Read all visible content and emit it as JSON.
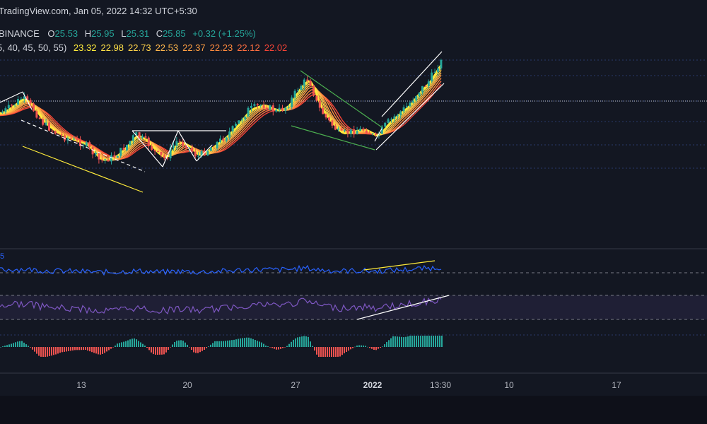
{
  "header": {
    "source": "TradingView.com, Jan 05, 2022 14:32 UTC+5:30",
    "exchange": "BINANCE",
    "ohlc": {
      "o_label": "O",
      "o": "25.53",
      "h_label": "H",
      "h": "25.95",
      "l_label": "L",
      "l": "25.31",
      "c_label": "C",
      "c": "25.85",
      "change": "+0.32 (+1.25%)"
    },
    "ma_params": "5, 40, 45, 50, 55)",
    "ma_values": [
      {
        "value": "23.32",
        "color": "#ffeb3b"
      },
      {
        "value": "22.98",
        "color": "#ffe047"
      },
      {
        "value": "22.73",
        "color": "#ffd24a"
      },
      {
        "value": "22.53",
        "color": "#ffb74d"
      },
      {
        "value": "22.37",
        "color": "#ff9f43"
      },
      {
        "value": "22.23",
        "color": "#ff8a3d"
      },
      {
        "value": "22.12",
        "color": "#ff6e40"
      },
      {
        "value": "22.02",
        "color": "#f44336"
      }
    ]
  },
  "osc_label": "5",
  "x_axis": [
    {
      "label": "13",
      "bold": false
    },
    {
      "label": "20",
      "bold": false
    },
    {
      "label": "27",
      "bold": false
    },
    {
      "label": "2022",
      "bold": true
    },
    {
      "label": "13:30",
      "bold": false
    },
    {
      "label": "10",
      "bold": false
    },
    {
      "label": "17",
      "bold": false
    }
  ],
  "colors": {
    "background": "#131722",
    "up": "#26a69a",
    "down": "#ef5350",
    "grid_dot": "#2a3a6a",
    "osc1": "#2962ff",
    "osc2": "#7e57c2",
    "trendline_yellow": "#ffeb3b",
    "trendline_green": "#4caf50",
    "trendline_white": "#ffffff"
  },
  "chart_data": {
    "type": "candlestick",
    "symbol_exchange": "BINANCE",
    "last": {
      "open": 25.53,
      "high": 25.95,
      "low": 25.31,
      "close": 25.85,
      "change": 0.32,
      "change_pct": 1.25
    },
    "moving_averages": [
      23.32,
      22.98,
      22.73,
      22.53,
      22.37,
      22.23,
      22.12,
      22.02
    ],
    "x_ticks": [
      "13",
      "20",
      "27",
      "2022",
      "13:30",
      "10",
      "17"
    ],
    "price_path": [
      {
        "t": "Jan 05 2022",
        "close": 25.85
      }
    ]
  }
}
